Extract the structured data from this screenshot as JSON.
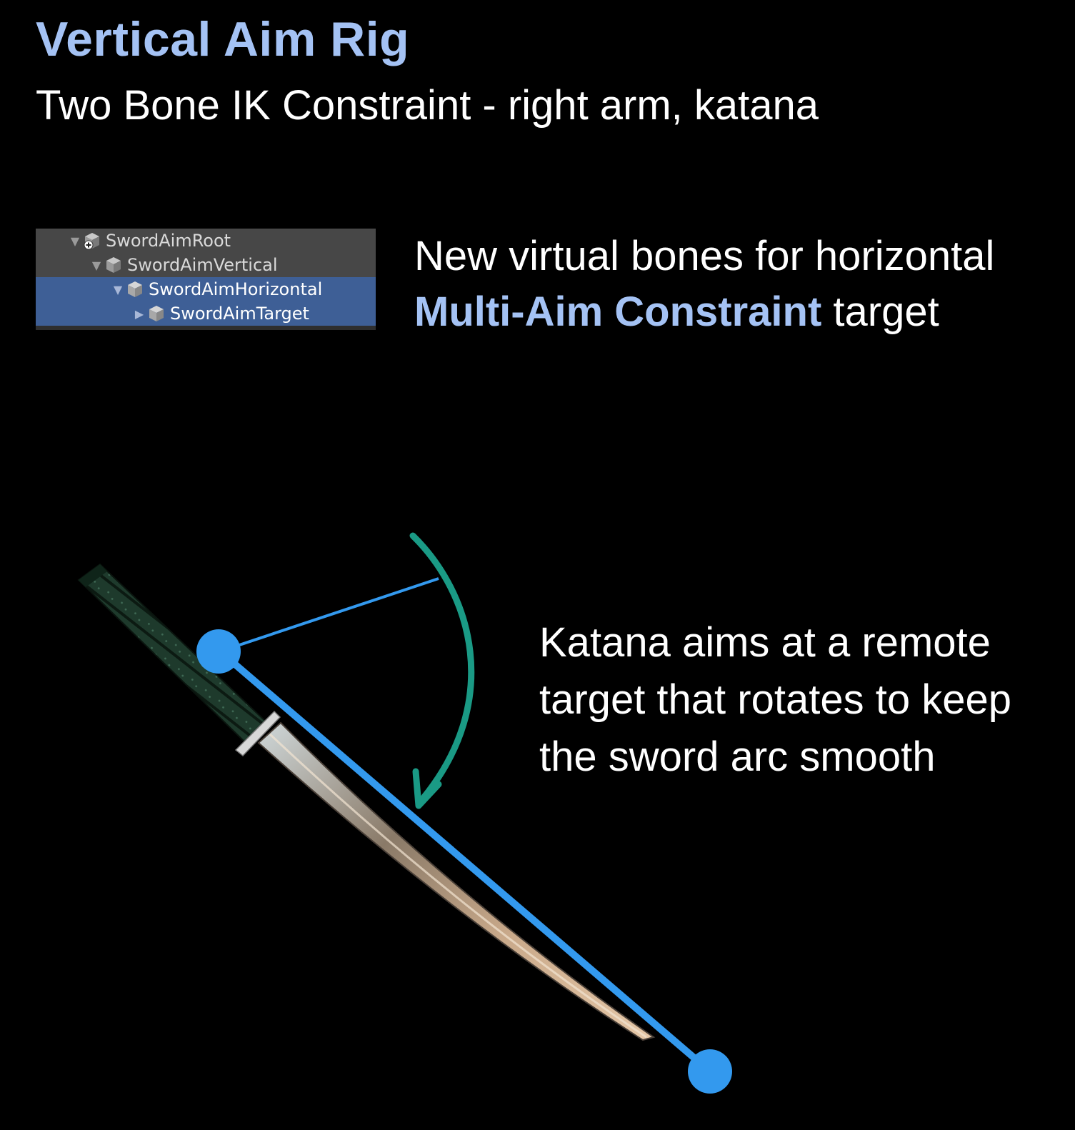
{
  "title": "Vertical Aim Rig",
  "subtitle": "Two Bone IK Constraint - right arm, katana",
  "hierarchy": {
    "items": [
      {
        "label": "SwordAimRoot",
        "selected": false
      },
      {
        "label": "SwordAimVertical",
        "selected": false
      },
      {
        "label": "SwordAimHorizontal",
        "selected": true
      },
      {
        "label": "SwordAimTarget",
        "selected": true
      }
    ]
  },
  "note_bones": {
    "line1": "New virtual bones for horizontal",
    "highlight": "Multi-Aim Constraint",
    "tail": " target"
  },
  "note_aim": {
    "line1": "Katana aims at a remote",
    "line2": "target that rotates to keep",
    "line3": "the sword arc smooth"
  },
  "colors": {
    "background": "#000000",
    "accent_text": "#a4c2f4",
    "aim_line": "#3399ee",
    "arc": "#1a9a85",
    "hierarchy_bg": "#474747",
    "hierarchy_selected": "#3e5f96"
  },
  "icons": {
    "expand": "triangle-down-icon",
    "collapsed": "triangle-right-icon",
    "object": "cube-icon",
    "root_object": "cube-plus-icon"
  }
}
